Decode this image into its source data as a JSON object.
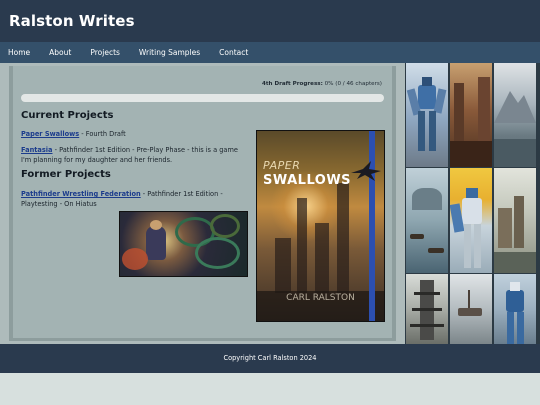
{
  "header": {
    "site_title": "Ralston Writes"
  },
  "nav": {
    "items": [
      {
        "label": "Home"
      },
      {
        "label": "About"
      },
      {
        "label": "Projects"
      },
      {
        "label": "Writing Samples"
      },
      {
        "label": "Contact"
      }
    ]
  },
  "progress": {
    "label": "4th Draft Progress:",
    "value_text": "0% (0 / 46 chapters)",
    "fraction": 0.0,
    "bar_color": "#4a6b8a"
  },
  "current_projects": {
    "heading": "Current Projects",
    "entries": [
      {
        "link": "Paper Swallows",
        "text": " - Fourth Draft"
      },
      {
        "link": "Fantasia",
        "text": " - Pathfinder 1st Edition - Pre-Play Phase - this is a game I'm planning for my daughter and her friends."
      }
    ]
  },
  "former_projects": {
    "heading": "Former Projects",
    "entries": [
      {
        "link": "Pathfinder Wrestling Federation",
        "text": " - Pathfinder 1st Edition - Playtesting - On Hiatus"
      }
    ]
  },
  "cover": {
    "title_line1": "PAPER",
    "title_line2": "SWALLOWS",
    "author": "CARL RALSTON"
  },
  "footer": {
    "copyright": "Copyright Carl Ralston 2024"
  },
  "colors": {
    "header_bg": "#2a3a4e",
    "nav_bg": "#34506a",
    "content_bg": "#a3b3b3",
    "link": "#1c3c8c"
  }
}
